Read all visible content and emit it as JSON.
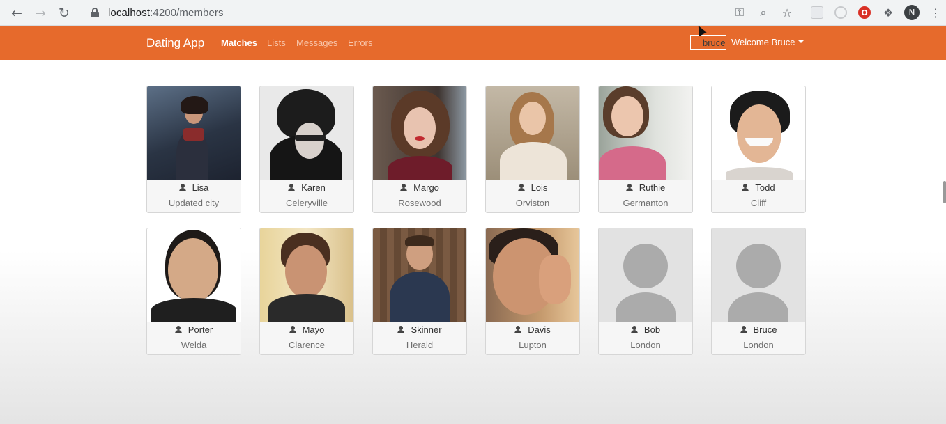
{
  "browser": {
    "url_host": "localhost",
    "url_path": ":4200/members",
    "profile_initial": "N"
  },
  "navbar": {
    "brand": "Dating App",
    "links": [
      {
        "label": "Matches",
        "active": true
      },
      {
        "label": "Lists",
        "active": false
      },
      {
        "label": "Messages",
        "active": false
      },
      {
        "label": "Errors",
        "active": false
      }
    ],
    "user_photo_alt": "bruce",
    "welcome": "Welcome Bruce",
    "accent_color": "#e66a2c"
  },
  "members": [
    {
      "name": "Lisa",
      "city": "Updated city",
      "photo": "photo"
    },
    {
      "name": "Karen",
      "city": "Celeryville",
      "photo": "photo"
    },
    {
      "name": "Margo",
      "city": "Rosewood",
      "photo": "photo"
    },
    {
      "name": "Lois",
      "city": "Orviston",
      "photo": "photo"
    },
    {
      "name": "Ruthie",
      "city": "Germanton",
      "photo": "photo"
    },
    {
      "name": "Todd",
      "city": "Cliff",
      "photo": "photo"
    },
    {
      "name": "Porter",
      "city": "Welda",
      "photo": "photo"
    },
    {
      "name": "Mayo",
      "city": "Clarence",
      "photo": "photo"
    },
    {
      "name": "Skinner",
      "city": "Herald",
      "photo": "photo"
    },
    {
      "name": "Davis",
      "city": "Lupton",
      "photo": "photo"
    },
    {
      "name": "Bob",
      "city": "London",
      "photo": "placeholder"
    },
    {
      "name": "Bruce",
      "city": "London",
      "photo": "placeholder"
    }
  ]
}
